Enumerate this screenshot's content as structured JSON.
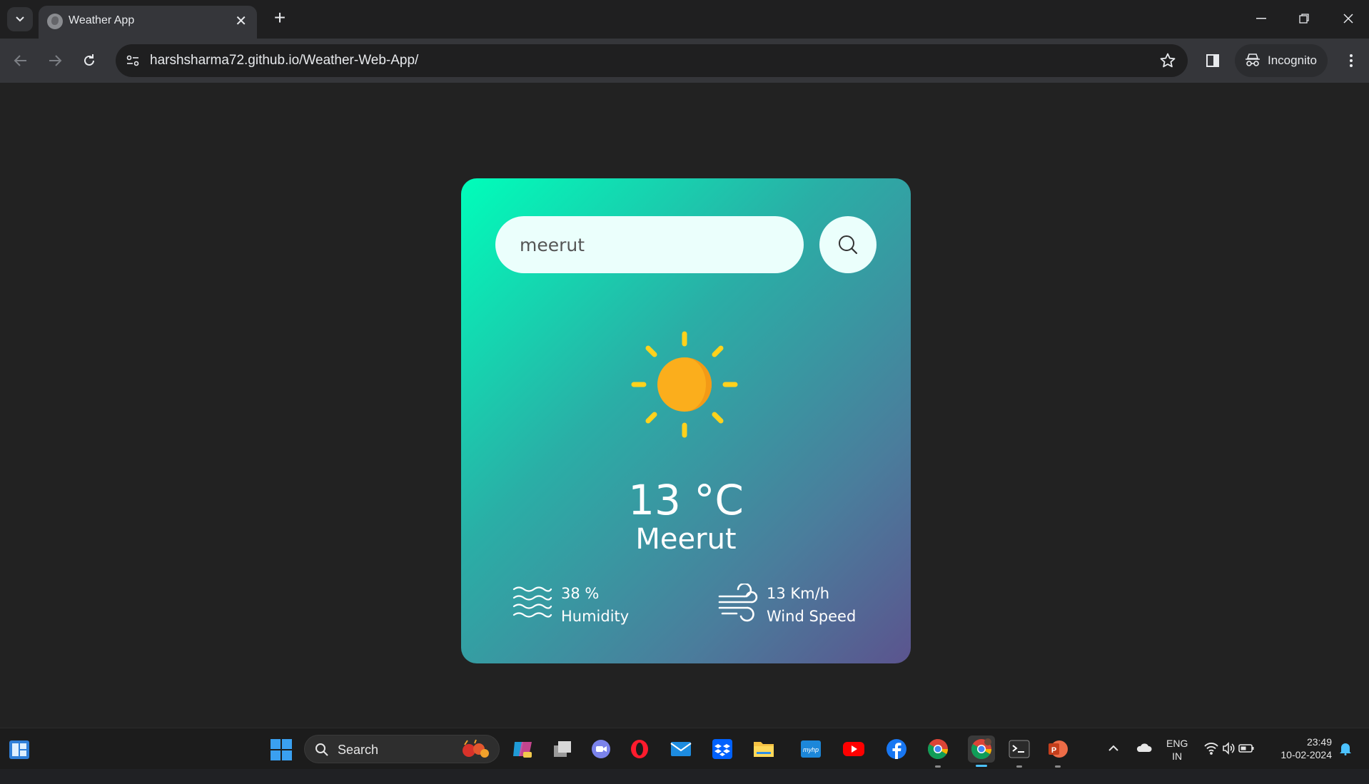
{
  "browser": {
    "tab_title": "Weather App",
    "url": "harshsharma72.github.io/Weather-Web-App/",
    "incognito_label": "Incognito"
  },
  "weather": {
    "search_value": "meerut",
    "temperature": "13 °C",
    "city": "Meerut",
    "humidity_value": "38 %",
    "humidity_label": "Humidity",
    "wind_value": "13 Km/h",
    "wind_label": "Wind Speed"
  },
  "taskbar": {
    "search_label": "Search",
    "language": "ENG",
    "region": "IN",
    "time": "23:49",
    "date": "10-02-2024"
  },
  "colors": {
    "card_gradient_start": "#00feba",
    "card_gradient_end": "#5b548e",
    "sun": "#ffb21d",
    "sun_rays": "#ffd21c"
  }
}
